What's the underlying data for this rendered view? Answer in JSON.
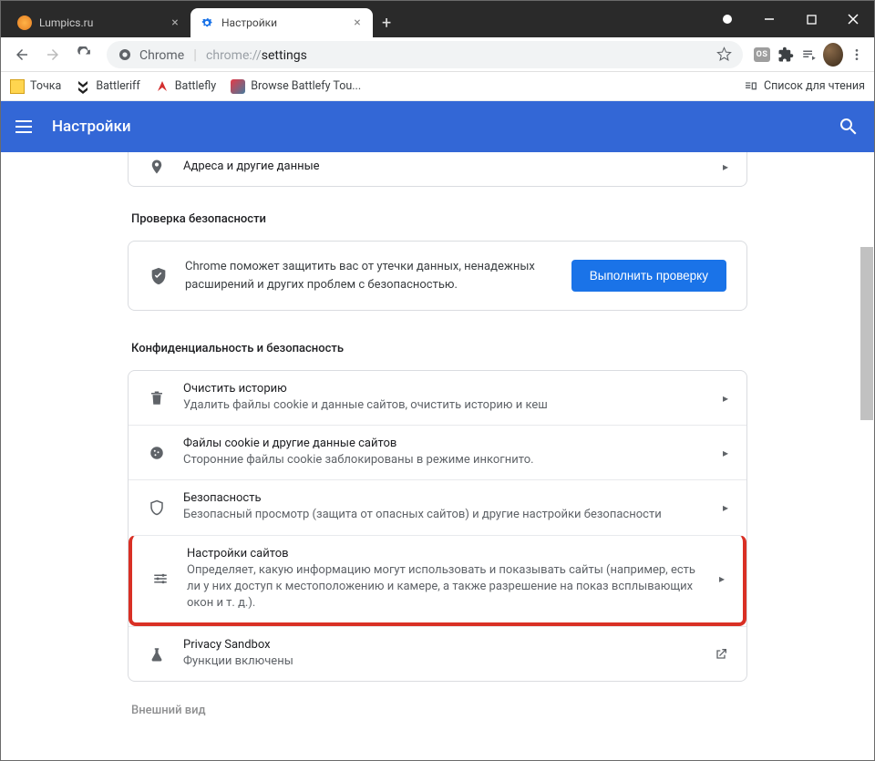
{
  "tabs": [
    {
      "title": "Lumpics.ru",
      "active": false
    },
    {
      "title": "Настройки",
      "active": true
    }
  ],
  "address": {
    "prefix": "Chrome",
    "scheme": "chrome://",
    "path": "settings"
  },
  "bookmarks": {
    "items": [
      {
        "label": "Точка"
      },
      {
        "label": "Battleriff"
      },
      {
        "label": "Battlefly"
      },
      {
        "label": "Browse Battlefy Tou..."
      }
    ],
    "reading_list": "Список для чтения"
  },
  "header": {
    "title": "Настройки"
  },
  "partial_row": {
    "label": "Адреса и другие данные"
  },
  "safety": {
    "section_title": "Проверка безопасности",
    "text": "Chrome поможет защитить вас от утечки данных, ненадежных расширений и других проблем с безопасностью.",
    "button": "Выполнить проверку"
  },
  "privacy": {
    "section_title": "Конфиденциальность и безопасность",
    "rows": [
      {
        "title": "Очистить историю",
        "sub": "Удалить файлы cookie и данные сайтов, очистить историю и кеш"
      },
      {
        "title": "Файлы cookie и другие данные сайтов",
        "sub": "Сторонние файлы cookie заблокированы в режиме инкогнито."
      },
      {
        "title": "Безопасность",
        "sub": "Безопасный просмотр (защита от опасных сайтов) и другие настройки безопасности"
      },
      {
        "title": "Настройки сайтов",
        "sub": "Определяет, какую информацию могут использовать и показывать сайты (например, есть ли у них доступ к местоположению и камере, а также разрешение на показ всплывающих окон и т. д.)."
      },
      {
        "title": "Privacy Sandbox",
        "sub": "Функции включены"
      }
    ]
  },
  "appearance_title": "Внешний вид",
  "last_badge": "OS"
}
